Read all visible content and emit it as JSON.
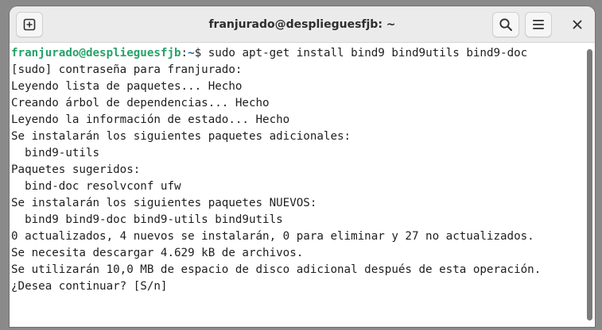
{
  "window": {
    "title": "franjurado@desplieguesfjb: ~"
  },
  "toolbar": {
    "new_tab_icon": "new-tab-icon",
    "search_icon": "search-icon",
    "menu_icon": "hamburger-menu-icon",
    "close_icon": "close-icon",
    "close_glyph": "✕"
  },
  "terminal": {
    "prompt": {
      "user_host": "franjurado@desplieguesfjb",
      "separator": ":",
      "path": "~",
      "symbol": "$ ",
      "command": "sudo apt-get install bind9 bind9utils bind9-doc"
    },
    "lines": [
      "[sudo] contraseña para franjurado:",
      "Leyendo lista de paquetes... Hecho",
      "Creando árbol de dependencias... Hecho",
      "Leyendo la información de estado... Hecho",
      "Se instalarán los siguientes paquetes adicionales:",
      "  bind9-utils",
      "Paquetes sugeridos:",
      "  bind-doc resolvconf ufw",
      "Se instalarán los siguientes paquetes NUEVOS:",
      "  bind9 bind9-doc bind9-utils bind9utils",
      "0 actualizados, 4 nuevos se instalarán, 0 para eliminar y 27 no actualizados.",
      "Se necesita descargar 4.629 kB de archivos.",
      "Se utilizarán 10,0 MB de espacio de disco adicional después de esta operación.",
      "¿Desea continuar? [S/n]"
    ]
  },
  "colors": {
    "prompt_user": "#26a269",
    "prompt_path": "#1a5fb4",
    "text": "#1e1e1e",
    "background": "#ffffff",
    "titlebar": "#ebebeb"
  }
}
